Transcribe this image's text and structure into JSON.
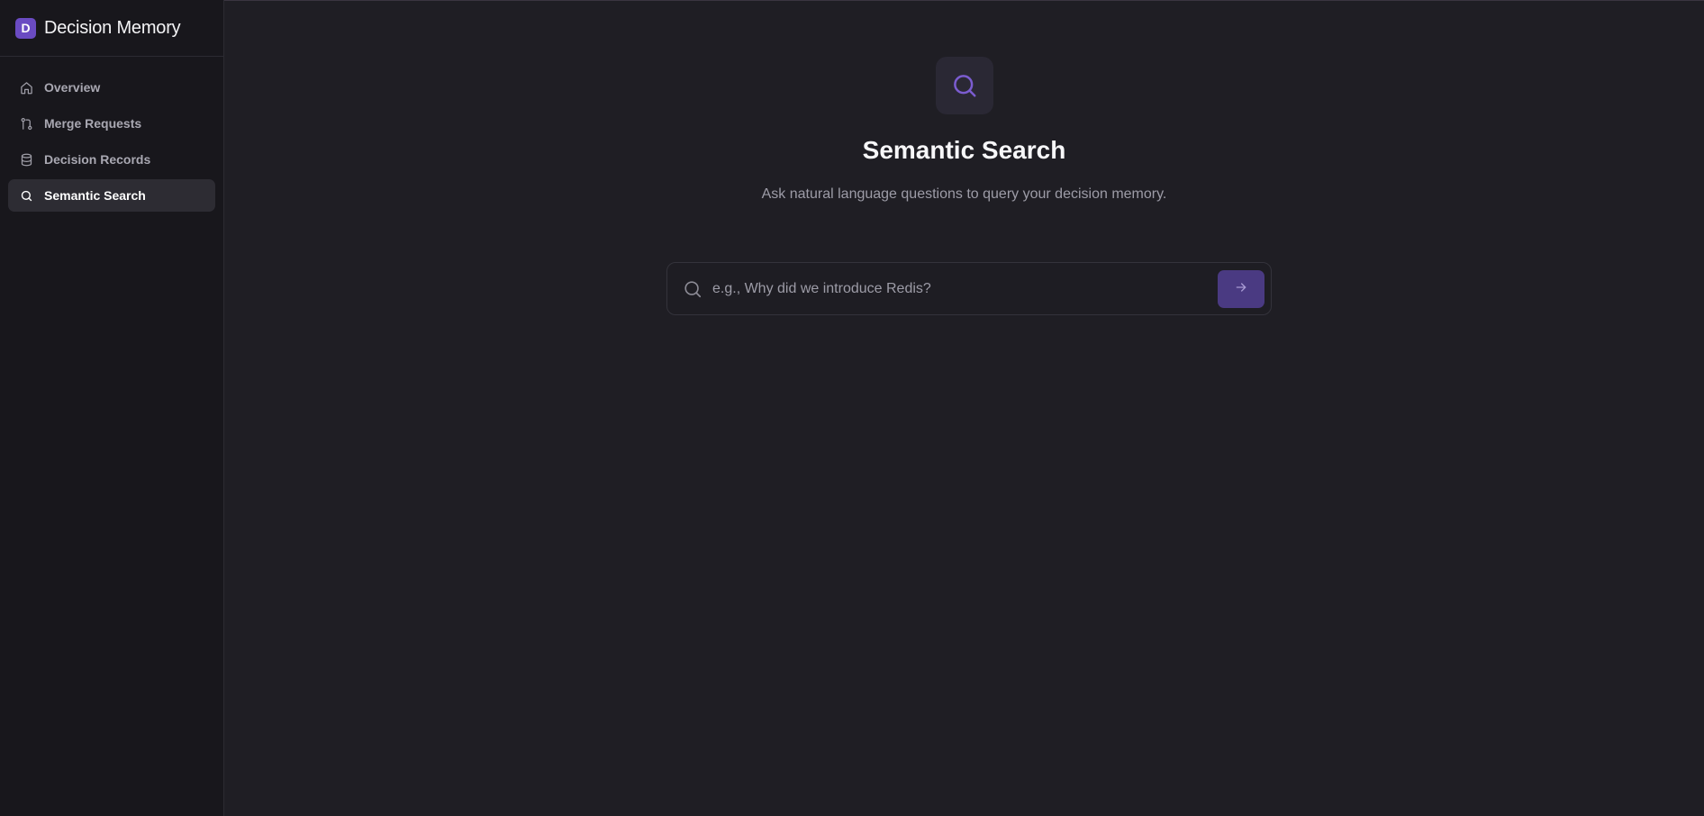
{
  "app": {
    "logo_letter": "D",
    "name": "Decision Memory",
    "accent_color": "#6a4bc2"
  },
  "sidebar": {
    "items": [
      {
        "label": "Overview",
        "icon": "home-icon",
        "active": false
      },
      {
        "label": "Merge Requests",
        "icon": "git-merge-icon",
        "active": false
      },
      {
        "label": "Decision Records",
        "icon": "database-icon",
        "active": false
      },
      {
        "label": "Semantic Search",
        "icon": "search-icon",
        "active": true
      }
    ]
  },
  "main": {
    "hero_icon": "search-icon",
    "title": "Semantic Search",
    "subtitle": "Ask natural language questions to query your decision memory."
  },
  "search": {
    "value": "",
    "placeholder": "e.g., Why did we introduce Redis?",
    "submit_icon": "arrow-right-icon"
  }
}
